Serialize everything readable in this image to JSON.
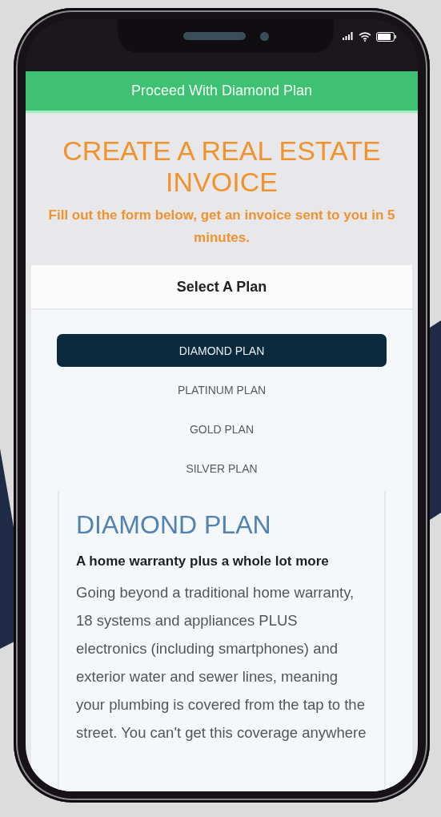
{
  "proceed_button": {
    "label": "Proceed With Diamond Plan"
  },
  "title": "CREATE A REAL ESTATE INVOICE",
  "subtitle": "Fill out the form below, get an invoice sent to you in 5 minutes.",
  "plan_card": {
    "header": "Select A Plan",
    "plans": [
      {
        "label": "DIAMOND PLAN",
        "selected": true
      },
      {
        "label": "PLATINUM PLAN",
        "selected": false
      },
      {
        "label": "GOLD PLAN",
        "selected": false
      },
      {
        "label": "SILVER PLAN",
        "selected": false
      }
    ],
    "details": {
      "heading": "DIAMOND PLAN",
      "subheading": "A home warranty plus a whole lot more",
      "description": "Going beyond a traditional home warranty, 18 systems and appliances PLUS electronics (including smartphones) and exterior water and sewer lines, meaning your plumbing is covered from the tap to the street. You can't get this coverage anywhere"
    }
  }
}
